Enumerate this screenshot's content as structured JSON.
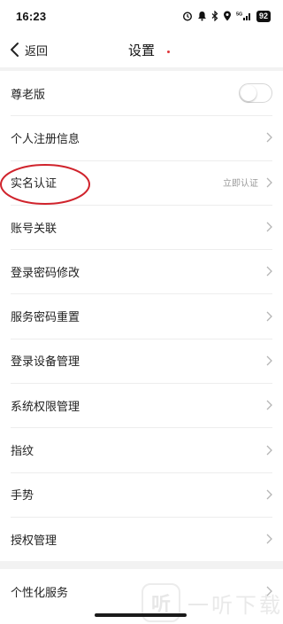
{
  "status_bar": {
    "time": "16:23",
    "battery": "92",
    "network": "5G"
  },
  "header": {
    "back_label": "返回",
    "title": "设置"
  },
  "settings": [
    {
      "key": "elder",
      "label": "尊老版",
      "type": "toggle",
      "on": false
    },
    {
      "key": "reg-info",
      "label": "个人注册信息",
      "type": "link"
    },
    {
      "key": "real-name",
      "label": "实名认证",
      "type": "link",
      "hint": "立即认证"
    },
    {
      "key": "account-link",
      "label": "账号关联",
      "type": "link"
    },
    {
      "key": "login-pwd",
      "label": "登录密码修改",
      "type": "link"
    },
    {
      "key": "service-pwd",
      "label": "服务密码重置",
      "type": "link"
    },
    {
      "key": "device-mgmt",
      "label": "登录设备管理",
      "type": "link"
    },
    {
      "key": "permission-mgmt",
      "label": "系统权限管理",
      "type": "link"
    },
    {
      "key": "fingerprint",
      "label": "指纹",
      "type": "link"
    },
    {
      "key": "gesture",
      "label": "手势",
      "type": "link"
    },
    {
      "key": "auth-mgmt",
      "label": "授权管理",
      "type": "link"
    }
  ],
  "settings_group2": [
    {
      "key": "personalized",
      "label": "个性化服务",
      "type": "link"
    }
  ],
  "watermark": {
    "logo_text": "听",
    "text": "一听下载"
  },
  "colors": {
    "annotation": "#d0232c",
    "background": "#f2f2f2",
    "hint": "#9a9a9a"
  }
}
